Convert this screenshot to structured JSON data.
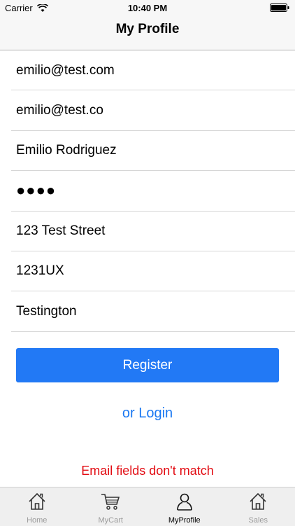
{
  "status_bar": {
    "carrier": "Carrier",
    "time": "10:40 PM",
    "icons": [
      "wifi-icon",
      "battery-icon"
    ]
  },
  "nav": {
    "title": "My Profile"
  },
  "form": {
    "fields": [
      {
        "name": "email",
        "value": "emilio@test.com"
      },
      {
        "name": "confirm-email",
        "value": "emilio@test.co"
      },
      {
        "name": "full-name",
        "value": "Emilio Rodriguez"
      },
      {
        "name": "password",
        "value": "●●●●"
      },
      {
        "name": "street",
        "value": "123 Test Street"
      },
      {
        "name": "postcode",
        "value": "1231UX"
      },
      {
        "name": "city",
        "value": "Testington"
      }
    ],
    "register_label": "Register",
    "login_label": "or Login",
    "error_message": "Email fields don't match"
  },
  "tab_bar": {
    "tabs": [
      {
        "label": "Home",
        "icon": "home-icon",
        "active": false
      },
      {
        "label": "MyCart",
        "icon": "cart-icon",
        "active": false
      },
      {
        "label": "MyProfile",
        "icon": "profile-icon",
        "active": true
      },
      {
        "label": "Sales",
        "icon": "home-icon",
        "active": false
      }
    ]
  },
  "colors": {
    "accent": "#2279f5",
    "link": "#1a78f2",
    "error": "#e20b12"
  }
}
